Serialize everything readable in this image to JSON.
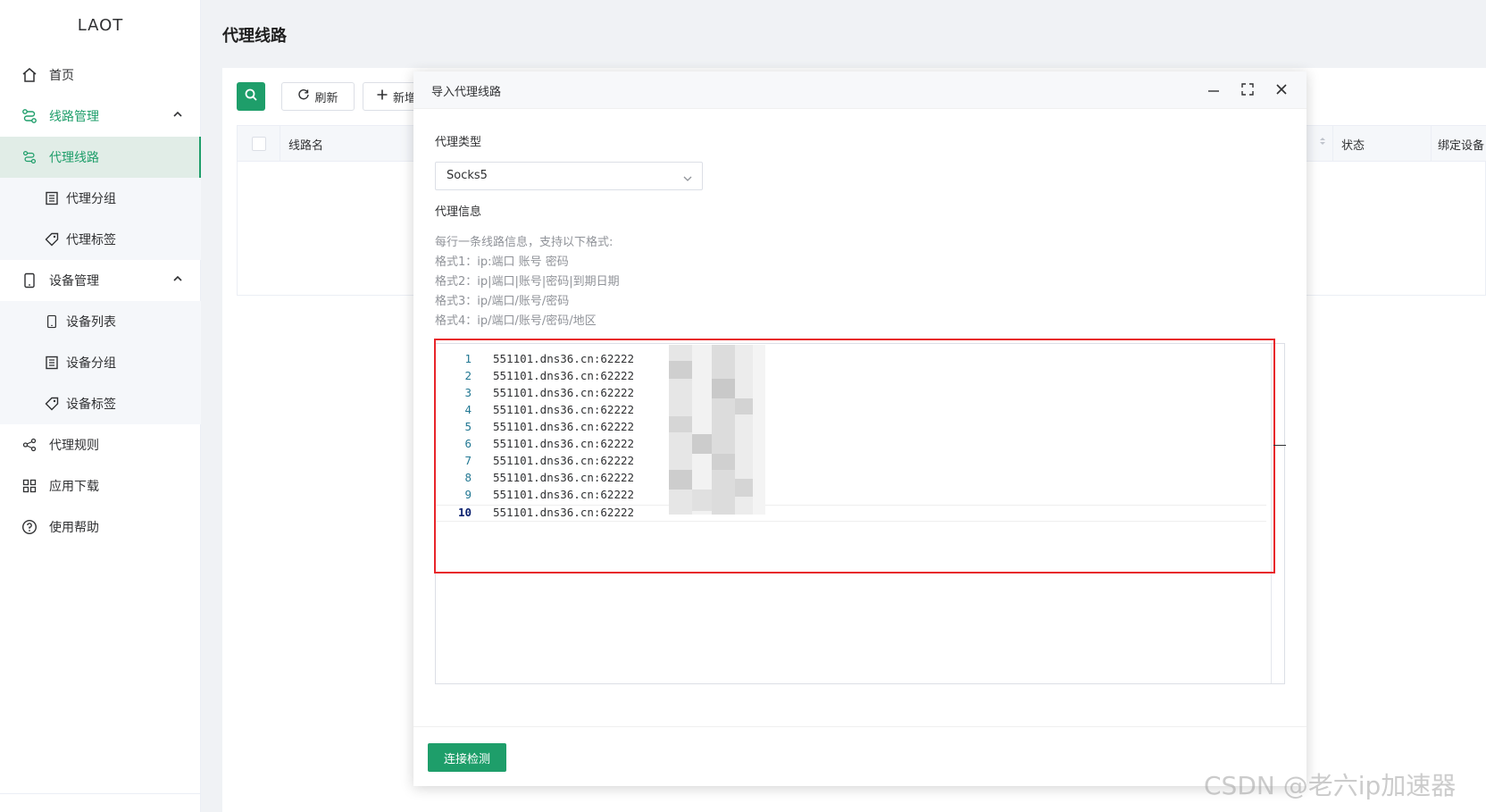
{
  "app": {
    "brand": "LAOT",
    "page_title": "代理线路"
  },
  "sidebar": {
    "items": [
      {
        "label": "首页",
        "icon": "home-icon"
      },
      {
        "label": "线路管理",
        "icon": "route-icon"
      },
      {
        "label": "代理线路",
        "icon": "route-icon"
      },
      {
        "label": "代理分组",
        "icon": "group-icon"
      },
      {
        "label": "代理标签",
        "icon": "tag-icon"
      },
      {
        "label": "设备管理",
        "icon": "phone-icon"
      },
      {
        "label": "设备列表",
        "icon": "phone-icon"
      },
      {
        "label": "设备分组",
        "icon": "group-icon"
      },
      {
        "label": "设备标签",
        "icon": "tag-icon"
      },
      {
        "label": "代理规则",
        "icon": "share-icon"
      },
      {
        "label": "应用下载",
        "icon": "apps-icon"
      },
      {
        "label": "使用帮助",
        "icon": "help-icon"
      }
    ]
  },
  "toolbar": {
    "refresh_label": "刷新",
    "new_label": "新增"
  },
  "table": {
    "columns": [
      "线路名",
      "状态",
      "绑定设备"
    ]
  },
  "dialog": {
    "title": "导入代理线路",
    "proxy_type_label": "代理类型",
    "proxy_type_value": "Socks5",
    "proxy_info_label": "代理信息",
    "hints": [
      "每行一条线路信息，支持以下格式:",
      "格式1：ip:端口 账号 密码",
      "格式2：ip|端口|账号|密码|到期日期",
      "格式3：ip/端口/账号/密码",
      "格式4：ip/端口/账号/密码/地区"
    ],
    "lines": [
      {
        "num": "1",
        "text": "551101.dns36.cn:62222"
      },
      {
        "num": "2",
        "text": "551101.dns36.cn:62222"
      },
      {
        "num": "3",
        "text": "551101.dns36.cn:62222"
      },
      {
        "num": "4",
        "text": "551101.dns36.cn:62222"
      },
      {
        "num": "5",
        "text": "551101.dns36.cn:62222"
      },
      {
        "num": "6",
        "text": "551101.dns36.cn:62222"
      },
      {
        "num": "7",
        "text": "551101.dns36.cn:62222"
      },
      {
        "num": "8",
        "text": "551101.dns36.cn:62222"
      },
      {
        "num": "9",
        "text": "551101.dns36.cn:62222"
      },
      {
        "num": "10",
        "text": "551101.dns36.cn:62222"
      }
    ],
    "check_button_label": "连接检测"
  },
  "watermark": "CSDN @老六ip加速器",
  "colors": {
    "accent": "#1e9e6a",
    "highlight_box": "#e8262b"
  }
}
